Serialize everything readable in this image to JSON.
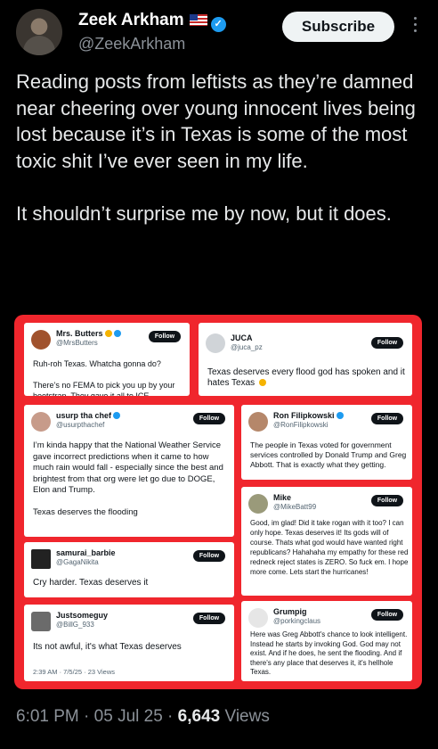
{
  "author": {
    "name": "Zeek Arkham",
    "handle": "@ZeekArkham",
    "subscribe_label": "Subscribe"
  },
  "tweet": {
    "text": "Reading posts from leftists as they’re damned near cheering over young innocent lives being lost because it’s in Texas is some of the most toxic shit I’ve ever seen in my life.\n\nIt shouldn’t surprise me by now, but it does."
  },
  "cards": [
    {
      "name": "Mrs. Butters",
      "handle": "@MrsButters",
      "follow": "Follow",
      "text": "Ruh-roh Texas. Whatcha gonna do?\n\nThere’s no FEMA to pick you up by your bootstrap. They gave it all to ICE."
    },
    {
      "name": "JUCA",
      "handle": "@juca_pz",
      "follow": "Follow",
      "text": "Texas deserves every flood god has spoken and it hates Texas"
    },
    {
      "name": "usurp tha chef",
      "handle": "@usurpthachef",
      "follow": "Follow",
      "text": "I’m kinda happy that the National Weather Service gave incorrect predictions when it came to how much rain would fall - especially since the best and brightest from that org were let go due to DOGE, Elon and Trump.\n\nTexas deserves the flooding"
    },
    {
      "name": "Ron Filipkowski",
      "handle": "@RonFilipkowski",
      "follow": "Follow",
      "text": "The people in Texas voted for government services controlled by Donald Trump and Greg Abbott. That is exactly what they getting."
    },
    {
      "name": "samurai_barbie",
      "handle": "@GagaNikita",
      "follow": "Follow",
      "text": "Cry harder. Texas deserves it"
    },
    {
      "name": "Mike",
      "handle": "@MikeBatt99",
      "follow": "Follow",
      "text": "Good, im glad! Did it take rogan with it too? I can only hope. Texas deserves it! Its gods will of course. Thats what god would have wanted right republicans? Hahahaha my empathy for these red redneck reject states is ZERO. So fuck em. I hope more come. Lets start the hurricanes!"
    },
    {
      "name": "Justsomeguy",
      "handle": "@BillG_933",
      "follow": "Follow",
      "text": "Its not awful, it's what Texas deserves",
      "meta": "2:39 AM · 7/5/25 · 23 Views"
    },
    {
      "name": "Grumpig",
      "handle": "@porkingclaus",
      "follow": "Follow",
      "text": "Here was Greg Abbott's chance to look intelligent. Instead he starts by invoking God. God may not exist. And if he does, he sent the flooding. And if there's any place that deserves it, it's hellhole Texas."
    }
  ],
  "footer": {
    "time": "6:01 PM",
    "date": "05 Jul 25",
    "views": "6,643",
    "views_label": "Views"
  }
}
